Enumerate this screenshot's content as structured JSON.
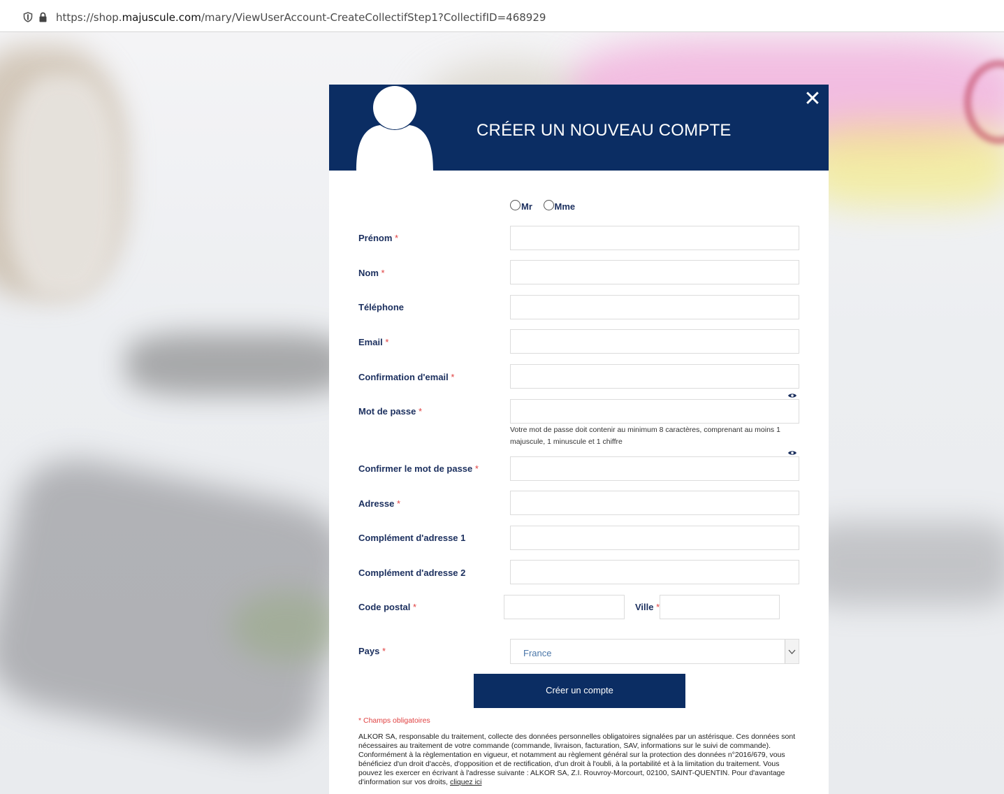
{
  "browser": {
    "url_prefix": "https://shop.",
    "url_domain": "majuscule.com",
    "url_path": "/mary/ViewUserAccount-CreateCollectifStep1?CollectifID=468929"
  },
  "modal": {
    "title": "CRÉER UN NOUVEAU COMPTE",
    "close_symbol": "✕",
    "civility": [
      {
        "label": "Mr"
      },
      {
        "label": "Mme"
      }
    ],
    "fields": {
      "prenom": {
        "label": "Prénom",
        "required": "*"
      },
      "nom": {
        "label": "Nom",
        "required": "*"
      },
      "telephone": {
        "label": "Téléphone"
      },
      "email": {
        "label": "Email",
        "required": "*"
      },
      "email_confirm": {
        "label": "Confirmation d'email",
        "required": "*"
      },
      "password": {
        "label": "Mot de passe",
        "required": "*"
      },
      "password_confirm": {
        "label": "Confirmer le mot de passe",
        "required": "*"
      },
      "adresse": {
        "label": "Adresse",
        "required": "*"
      },
      "complement1": {
        "label": "Complément d'adresse 1"
      },
      "complement2": {
        "label": "Complément d'adresse 2"
      },
      "code_postal": {
        "label": "Code postal",
        "required": "*"
      },
      "ville": {
        "label": "Ville",
        "required": "*"
      },
      "pays": {
        "label": "Pays",
        "required": "*",
        "value": "France"
      }
    },
    "password_hint": "Votre mot de passe doit contenir au minimum 8 caractères, comprenant au moins 1 majuscule, 1 minuscule et 1 chiffre",
    "submit_label": "Créer un compte",
    "mandatory_note": "* Champs obligatoires",
    "legal_text": "ALKOR SA, responsable du traitement, collecte des données personnelles obligatoires signalées par un astérisque. Ces données sont nécessaires au traitement de votre commande (commande, livraison, facturation, SAV, informations sur le suivi de commande). Conformément à la règlementation en vigueur, et notamment au règlement général sur la protection des données n°2016/679, vous bénéficiez d'un droit d'accès, d'opposition et de rectification, d'un droit à l'oubli, à la portabilité et à la limitation du traitement. Vous pouvez les exercer en écrivant à l'adresse suivante : ALKOR SA, Z.I. Rouvroy-Morcourt, 02100, SAINT-QUENTIN. Pour d'avantage d'information sur vos droits,",
    "legal_link": "cliquez ici"
  },
  "colors": {
    "primary_navy": "#0b2d63",
    "required_red": "#e04040",
    "label_navy": "#1b2f5e"
  },
  "icons": [
    "shield-icon",
    "lock-icon",
    "user-avatar-icon",
    "close-icon",
    "eye-icon",
    "chevron-down-icon"
  ]
}
